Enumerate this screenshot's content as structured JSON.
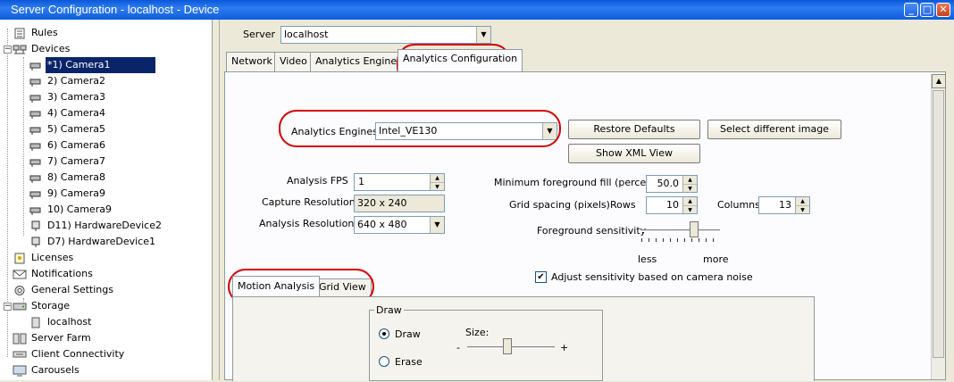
{
  "window": {
    "title": "Server Configuration - localhost - Device"
  },
  "tree": {
    "rules": "Rules",
    "devices": "Devices",
    "cameras": [
      "*1) Camera1",
      "2) Camera2",
      "3) Camera3",
      "4) Camera4",
      "5) Camera5",
      "6) Camera6",
      "7) Camera7",
      "8) Camera8",
      "9) Camera9",
      "10) Camera9"
    ],
    "hardware": [
      "D11) HardwareDevice2",
      "D7) HardwareDevice1"
    ],
    "licenses": "Licenses",
    "notifications": "Notifications",
    "general_settings": "General Settings",
    "storage": "Storage",
    "storage_child": "localhost",
    "server_farm": "Server Farm",
    "client_connectivity": "Client Connectivity",
    "carousels": "Carousels"
  },
  "server": {
    "label": "Server",
    "value": "localhost"
  },
  "tabs": [
    "Network",
    "Video",
    "Analytics Engines",
    "Analytics Configuration"
  ],
  "config": {
    "engines_label": "Analytics Engines",
    "engines_value": "Intel_VE130",
    "restore_defaults": "Restore Defaults",
    "select_image": "Select different image",
    "show_xml": "Show XML View",
    "fps_label": "Analysis FPS",
    "fps_value": "1",
    "capture_res_label": "Capture Resolution",
    "capture_res_value": "320 x 240",
    "analysis_res_label": "Analysis Resolution",
    "analysis_res_value": "640 x 480",
    "min_fill_label": "Minimum foreground fill (percent)",
    "min_fill_value": "50.0",
    "grid_label": "Grid spacing (pixels)",
    "rows_label": "Rows",
    "rows_value": "10",
    "columns_label": "Columns",
    "columns_value": "13",
    "sensitivity_label": "Foreground sensitivity",
    "less": "less",
    "more": "more",
    "adjust_label": "Adjust sensitivity based on camera noise",
    "adjust_checked": true
  },
  "subtabs": [
    "Motion Analysis",
    "Grid View"
  ],
  "draw": {
    "group_label": "Draw",
    "draw_option": "Draw",
    "erase_option": "Erase",
    "size_label": "Size:",
    "minus": "-",
    "plus": "+"
  }
}
